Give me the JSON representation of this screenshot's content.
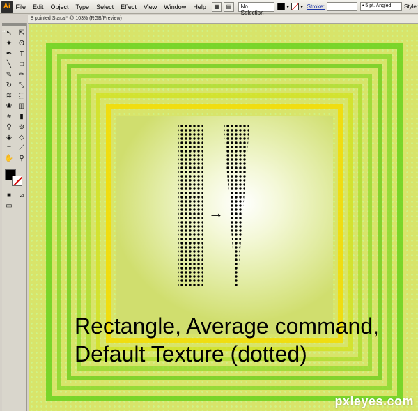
{
  "app": {
    "logo": "Ai",
    "menus": [
      "File",
      "Edit",
      "Object",
      "Type",
      "Select",
      "Effect",
      "View",
      "Window",
      "Help"
    ]
  },
  "control": {
    "selection": "No Selection",
    "stroke_label": "Stroke:",
    "brush": "5 pt. Angled",
    "style_label": "Style:"
  },
  "document": {
    "tab_title": "8 pointed Star.ai* @ 103% (RGB/Preview)"
  },
  "tools": {
    "panel_label": "44",
    "icons": [
      "selection-tool-icon",
      "direct-selection-tool-icon",
      "magic-wand-tool-icon",
      "lasso-tool-icon",
      "pen-tool-icon",
      "type-tool-icon",
      "line-tool-icon",
      "rectangle-tool-icon",
      "paintbrush-tool-icon",
      "pencil-tool-icon",
      "rotate-tool-icon",
      "scale-tool-icon",
      "warp-tool-icon",
      "free-transform-tool-icon",
      "symbol-sprayer-tool-icon",
      "column-graph-tool-icon",
      "mesh-tool-icon",
      "gradient-tool-icon",
      "eyedropper-tool-icon",
      "blend-tool-icon",
      "live-paint-tool-icon",
      "live-paint-selection-icon",
      "crop-tool-icon",
      "slice-tool-icon",
      "hand-tool-icon",
      "zoom-tool-icon"
    ],
    "fill_color": "#000000",
    "stroke_color": "#ffffff"
  },
  "canvas": {
    "arrow": "→",
    "caption_line1": "Rectangle, Average command,",
    "caption_line2": "Default Texture (dotted)",
    "watermark": "pxleyes.com",
    "colors": {
      "outer_green": "#7ed321",
      "inner_yellow": "#f5e400",
      "background": "#d8e46a"
    }
  }
}
